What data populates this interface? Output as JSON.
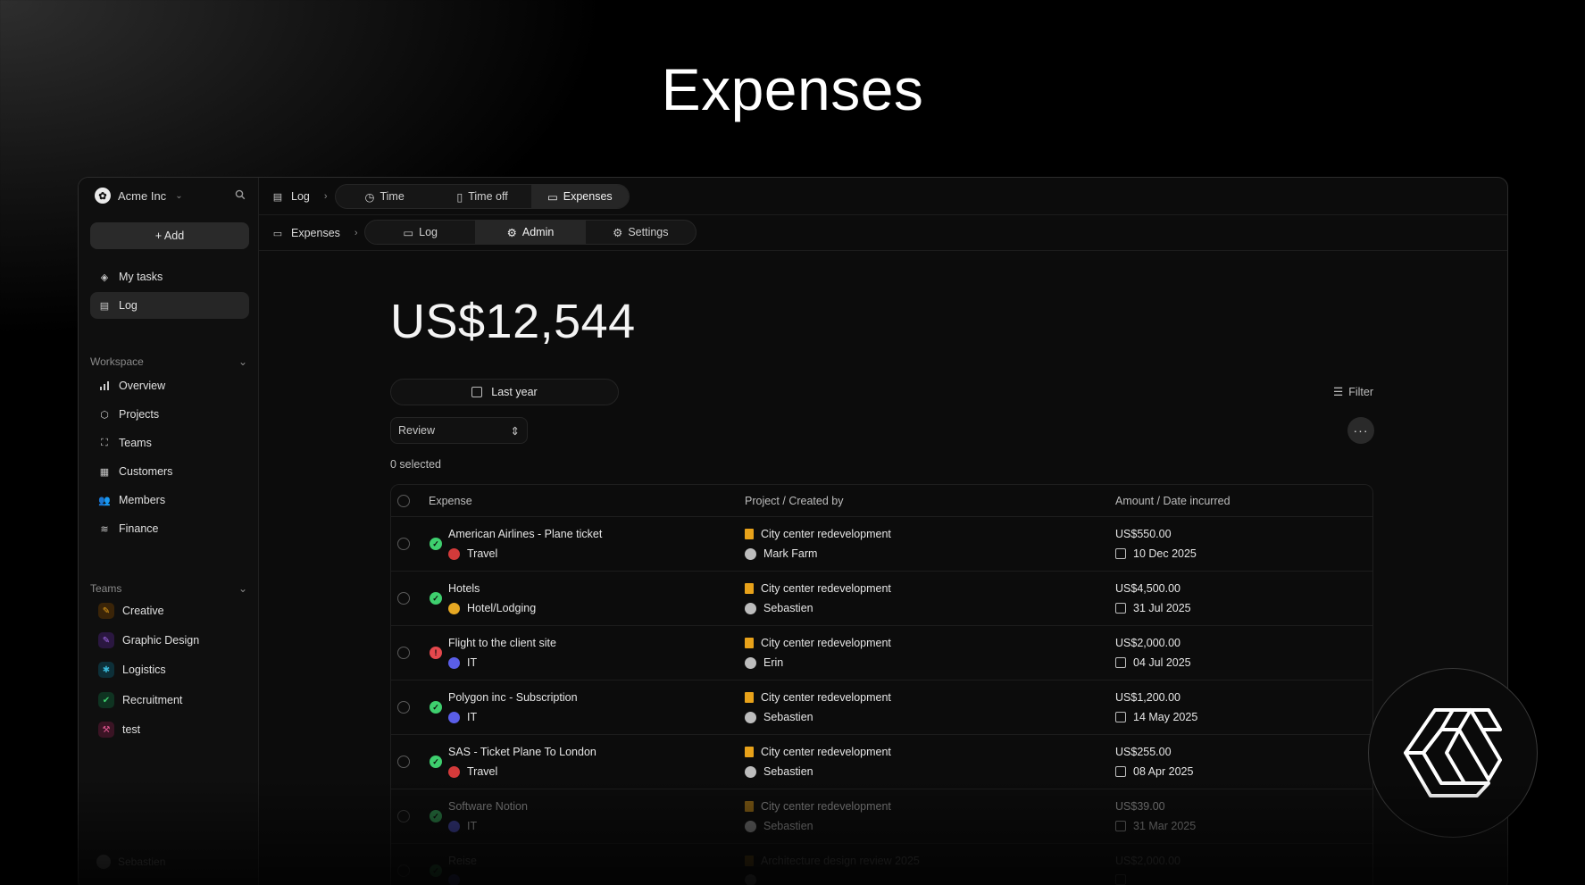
{
  "hero": {
    "title": "Expenses"
  },
  "sidebar": {
    "org_name": "Acme Inc",
    "add_label": "+ Add",
    "primary": [
      {
        "label": "My tasks",
        "icon": "layers-icon"
      },
      {
        "label": "Log",
        "icon": "log-icon",
        "active": true
      }
    ],
    "workspace_label": "Workspace",
    "workspace": [
      {
        "label": "Overview",
        "icon": "bar-chart-icon"
      },
      {
        "label": "Projects",
        "icon": "box-icon"
      },
      {
        "label": "Teams",
        "icon": "focus-icon"
      },
      {
        "label": "Customers",
        "icon": "building-icon"
      },
      {
        "label": "Members",
        "icon": "users-icon"
      },
      {
        "label": "Finance",
        "icon": "database-icon"
      }
    ],
    "teams_label": "Teams",
    "teams": [
      {
        "label": "Creative",
        "color": "#c87a1c"
      },
      {
        "label": "Graphic Design",
        "color": "#8a4bd6"
      },
      {
        "label": "Logistics",
        "color": "#1f8fa8"
      },
      {
        "label": "Recruitment",
        "color": "#21a060"
      },
      {
        "label": "test",
        "color": "#b8336a"
      }
    ],
    "user_name": "Sebastien"
  },
  "topbar": {
    "crumb": "Log",
    "tabs": [
      {
        "label": "Time",
        "icon": "clock-icon"
      },
      {
        "label": "Time off",
        "icon": "building-icon"
      },
      {
        "label": "Expenses",
        "icon": "cash-icon",
        "selected": true
      }
    ]
  },
  "subbar": {
    "crumb": "Expenses",
    "tabs": [
      {
        "label": "Log",
        "icon": "cash-icon"
      },
      {
        "label": "Admin",
        "icon": "admin-icon",
        "selected": true
      },
      {
        "label": "Settings",
        "icon": "gear-icon"
      }
    ]
  },
  "content": {
    "total": "US$12,544",
    "date_range": "Last year",
    "filter_label": "Filter",
    "review_select": "Review",
    "selected_count": "0 selected",
    "columns": [
      "Expense",
      "Project / Created by",
      "Amount / Date incurred"
    ]
  },
  "rows": [
    {
      "title": "American Airlines -  Plane ticket",
      "category": "Travel",
      "cat_color": "#d33a3a",
      "status": "ok",
      "project": "City center redevelopment",
      "creator": "Mark Farm",
      "amount": "US$550.00",
      "date": "10 Dec 2025"
    },
    {
      "title": "Hotels",
      "category": "Hotel/Lodging",
      "cat_color": "#e6a823",
      "status": "ok",
      "project": "City center redevelopment",
      "creator": "Sebastien",
      "amount": "US$4,500.00",
      "date": "31 Jul 2025"
    },
    {
      "title": "Flight to the client site",
      "category": "IT",
      "cat_color": "#5a5ee8",
      "status": "warn",
      "project": "City center redevelopment",
      "creator": "Erin",
      "amount": "US$2,000.00",
      "date": "04 Jul 2025"
    },
    {
      "title": "Polygon inc -  Subscription",
      "category": "IT",
      "cat_color": "#5a5ee8",
      "status": "ok",
      "project": "City center redevelopment",
      "creator": "Sebastien",
      "amount": "US$1,200.00",
      "date": "14 May 2025"
    },
    {
      "title": "SAS -  Ticket Plane To London",
      "category": "Travel",
      "cat_color": "#d33a3a",
      "status": "ok",
      "project": "City center redevelopment",
      "creator": "Sebastien",
      "amount": "US$255.00",
      "date": "08 Apr 2025"
    },
    {
      "title": "Software Notion",
      "category": "IT",
      "cat_color": "#5a5ee8",
      "status": "ok",
      "project": "City center redevelopment",
      "creator": "Sebastien",
      "amount": "US$39.00",
      "date": "31 Mar 2025"
    },
    {
      "title": "Reise",
      "category": "",
      "cat_color": "#5a5ee8",
      "status": "ok",
      "project": "Architecture design review 2025",
      "creator": "",
      "amount": "US$2,000.00",
      "date": ""
    }
  ],
  "colors": {
    "ok": "#3ecf6e",
    "warn": "#e5484d",
    "project_icon": "#e8a21a"
  }
}
